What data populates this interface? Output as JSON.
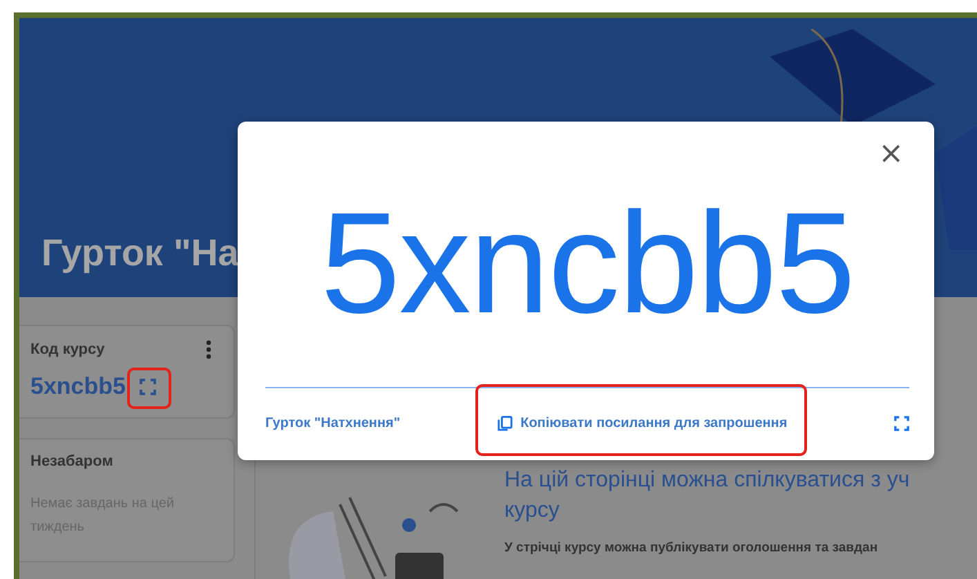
{
  "banner": {
    "title": "Гурток \"На"
  },
  "class_code_card": {
    "label": "Код курсу",
    "code": "5xncbb5",
    "fullscreen_highlighted": true
  },
  "upcoming_card": {
    "title": "Незабаром",
    "text": "Немає завдань на цей тиждень"
  },
  "stream_intro": {
    "heading_lines": [
      "На цій сторінці можна спілкуватися з уч",
      "курсу"
    ],
    "text": "У стрічці курсу можна публікувати оголошення та завдан"
  },
  "dialog": {
    "close": "×",
    "code": "5xncbb5",
    "class_name": "Гурток \"Натхнення\"",
    "copy_link": "Копіювати посилання для запрошення",
    "copy_link_highlighted": true
  }
}
